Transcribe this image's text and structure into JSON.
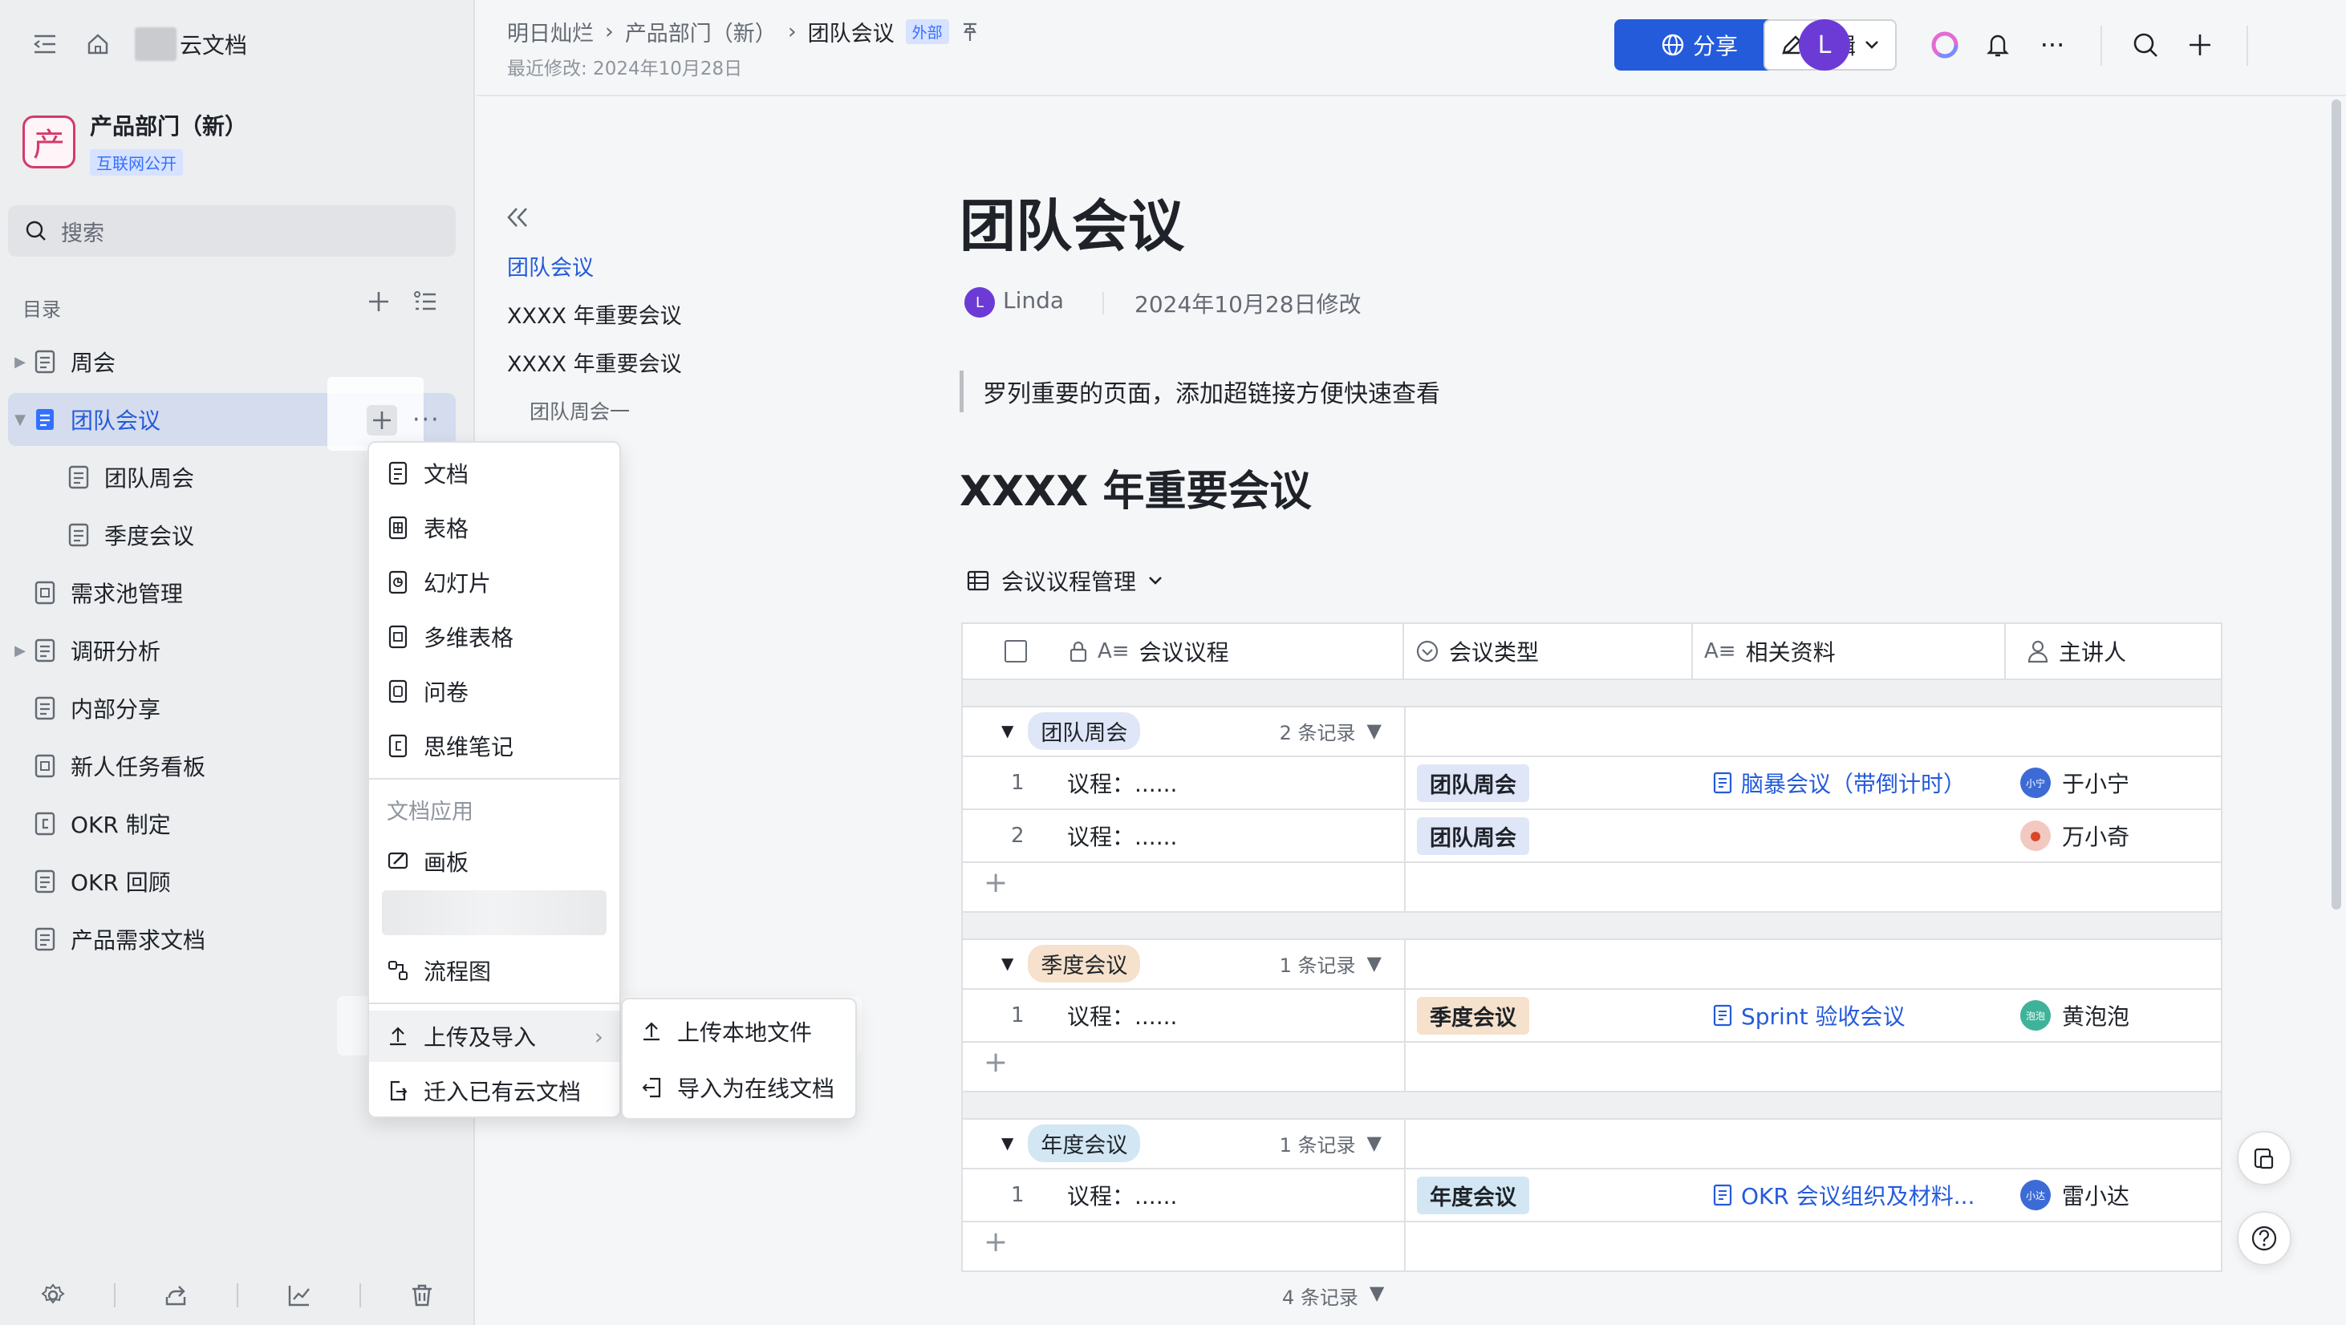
{
  "sidebar": {
    "brand": "云文档",
    "workspace": {
      "logo_char": "产",
      "name": "产品部门（新）",
      "badge": "互联网公开"
    },
    "search_placeholder": "搜索",
    "toc_label": "目录",
    "items": [
      {
        "label": "周会",
        "expandable": true
      },
      {
        "label": "团队会议",
        "expandable": true,
        "active": true
      },
      {
        "label": "团队周会",
        "child": true
      },
      {
        "label": "季度会议",
        "child": true
      },
      {
        "label": "需求池管理"
      },
      {
        "label": "调研分析",
        "expandable": true
      },
      {
        "label": "内部分享"
      },
      {
        "label": "新人任务看板"
      },
      {
        "label": "OKR 制定"
      },
      {
        "label": "OKR 回顾"
      },
      {
        "label": "产品需求文档"
      }
    ]
  },
  "header": {
    "breadcrumbs": [
      "明日灿烂",
      "产品部门（新）",
      "团队会议"
    ],
    "external_tag": "外部",
    "modified": "最近修改: 2024年10月28日",
    "share_label": "分享",
    "edit_label": "编辑",
    "avatar_initial": "L"
  },
  "outline": {
    "items": [
      "团队会议",
      "XXXX 年重要会议",
      "XXXX 年重要会议",
      "团队周会一"
    ]
  },
  "doc": {
    "title": "团队会议",
    "author": "Linda",
    "author_initial": "L",
    "modified": "2024年10月28日修改",
    "quote": "罗列重要的页面，添加超链接方便快速查看",
    "heading": "XXXX 年重要会议",
    "view_name": "会议议程管理",
    "table": {
      "columns": [
        "会议议程",
        "会议类型",
        "相关资料",
        "主讲人"
      ],
      "groups": [
        {
          "name": "团队周会",
          "count": "2 条记录",
          "color": "#dfe6f7",
          "rows": [
            {
              "n": "1",
              "agenda": "议程：......",
              "type": "团队周会",
              "doc": "脑暴会议（带倒计时）",
              "speaker": "于小宁",
              "av": "小宁",
              "av_color": "#3d6bd6"
            },
            {
              "n": "2",
              "agenda": "议程：......",
              "type": "团队周会",
              "doc": "",
              "speaker": "万小奇",
              "av": "",
              "av_color": "#f2c9c0"
            }
          ]
        },
        {
          "name": "季度会议",
          "count": "1 条记录",
          "color": "#f5e1cc",
          "rows": [
            {
              "n": "1",
              "agenda": "议程：......",
              "type": "季度会议",
              "doc": "Sprint 验收会议",
              "speaker": "黄泡泡",
              "av": "泡泡",
              "av_color": "#3fb39a"
            }
          ]
        },
        {
          "name": "年度会议",
          "count": "1 条记录",
          "color": "#d2e7f3",
          "rows": [
            {
              "n": "1",
              "agenda": "议程：......",
              "type": "年度会议",
              "doc": "OKR 会议组织及材料...",
              "speaker": "雷小达",
              "av": "小达",
              "av_color": "#3d6bd6"
            }
          ]
        }
      ],
      "total": "4 条记录"
    }
  },
  "menu": {
    "items": [
      "文档",
      "表格",
      "幻灯片",
      "多维表格",
      "问卷",
      "思维笔记"
    ],
    "section": "文档应用",
    "apps": [
      "画板",
      "流程图"
    ],
    "upload": "上传及导入",
    "migrate": "迁入已有云文档",
    "submenu": [
      "上传本地文件",
      "导入为在线文档"
    ]
  },
  "colors": {
    "accent": "#245bdb",
    "brand_pink": "#d43a6a"
  }
}
